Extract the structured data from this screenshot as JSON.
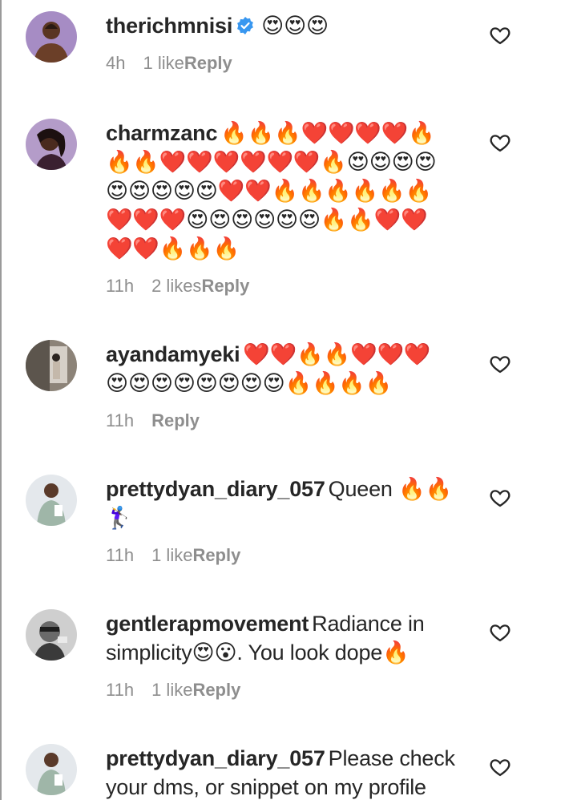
{
  "comments": [
    {
      "username": "therichmnisi",
      "verified": true,
      "text": "😍😍😍",
      "time": "4h",
      "likes": "1 like",
      "reply": "Reply"
    },
    {
      "username": "charmzanc",
      "verified": false,
      "text": "🔥🔥🔥❤️❤️❤️❤️🔥🔥🔥❤️❤️❤️❤️❤️❤️🔥😍😍😍😍😍😍😍😍😍❤️❤️🔥🔥🔥🔥🔥🔥❤️❤️❤️😍😍😍😍😍😍🔥🔥❤️❤️❤️❤️🔥🔥🔥",
      "time": "11h",
      "likes": "2 likes",
      "reply": "Reply"
    },
    {
      "username": "ayandamyeki",
      "verified": false,
      "text": "❤️❤️🔥🔥❤️❤️❤️😍😍😍😍😍😍😍😍🔥🔥🔥🔥",
      "time": "11h",
      "likes": "",
      "reply": "Reply"
    },
    {
      "username": "prettydyan_diary_057",
      "verified": false,
      "text": "Queen 🔥🔥🏌️‍♀️",
      "time": "11h",
      "likes": "1 like",
      "reply": "Reply"
    },
    {
      "username": "gentlerapmovement",
      "verified": false,
      "text": "Radiance in simplicity😍😮. You look dope🔥",
      "time": "11h",
      "likes": "1 like",
      "reply": "Reply"
    },
    {
      "username": "prettydyan_diary_057",
      "verified": false,
      "text": "Please check your dms, or snippet on my profile",
      "time": "",
      "likes": "",
      "reply": ""
    }
  ],
  "icons": {
    "verified": "verified-badge-icon",
    "like": "heart-outline-icon"
  },
  "colors": {
    "verified": "#3897f0",
    "meta": "#8e8e8e",
    "text": "#262626"
  }
}
